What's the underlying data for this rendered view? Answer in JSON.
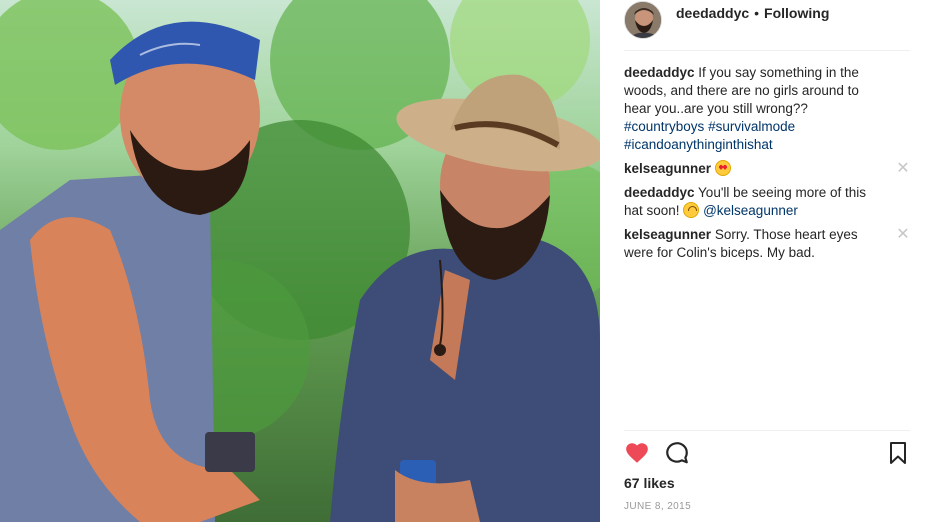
{
  "post": {
    "author": "deedaddyc",
    "follow_separator": "•",
    "follow_status": "Following"
  },
  "comments": [
    {
      "user": "deedaddyc",
      "text": "If you say something in the woods, and there are no girls around to hear you..are you still wrong??",
      "hashtags": [
        "#countryboys",
        "#survivalmode",
        "#icandoanythinginthishat"
      ],
      "removable": false
    },
    {
      "user": "kelseagunner",
      "text": "",
      "emoji": "heart-eyes-emoji",
      "removable": true
    },
    {
      "user": "deedaddyc",
      "text": "You'll be seeing more of this hat soon!",
      "emoji": "upside-down-face-emoji",
      "mention": "@kelseagunner",
      "removable": false
    },
    {
      "user": "kelseagunner",
      "text": "Sorry. Those heart eyes were for Colin's biceps. My bad.",
      "removable": true
    }
  ],
  "close_glyph": "✕",
  "actions": {
    "like_icon": "heart-icon",
    "comment_icon": "comment-bubble-icon",
    "save_icon": "bookmark-icon",
    "liked_color": "#ed4956"
  },
  "likes_text": "67 likes",
  "date_text": "JUNE 8, 2015",
  "colors": {
    "text": "#262626",
    "link": "#003569",
    "muted": "#999999",
    "divider": "#efefef"
  }
}
